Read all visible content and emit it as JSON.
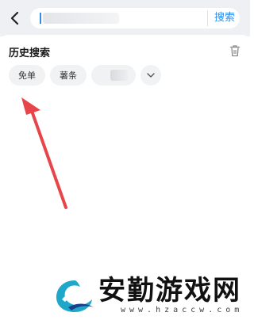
{
  "header": {
    "back_icon": "chevron-left-icon",
    "search": {
      "value": "",
      "placeholder": ""
    },
    "search_button_label": "搜索",
    "accent_color": "#2b8ef3"
  },
  "history": {
    "title": "历史搜索",
    "delete_icon": "trash-icon",
    "chips": [
      {
        "label": "免单"
      },
      {
        "label": "薯条"
      },
      {
        "label": ""
      }
    ],
    "expand_icon": "chevron-down-icon"
  },
  "annotation": {
    "color": "#e8454a",
    "icon": "red-arrow-icon"
  },
  "watermark": {
    "title": "安勤游戏网",
    "url": "www.hzaccw.com"
  }
}
